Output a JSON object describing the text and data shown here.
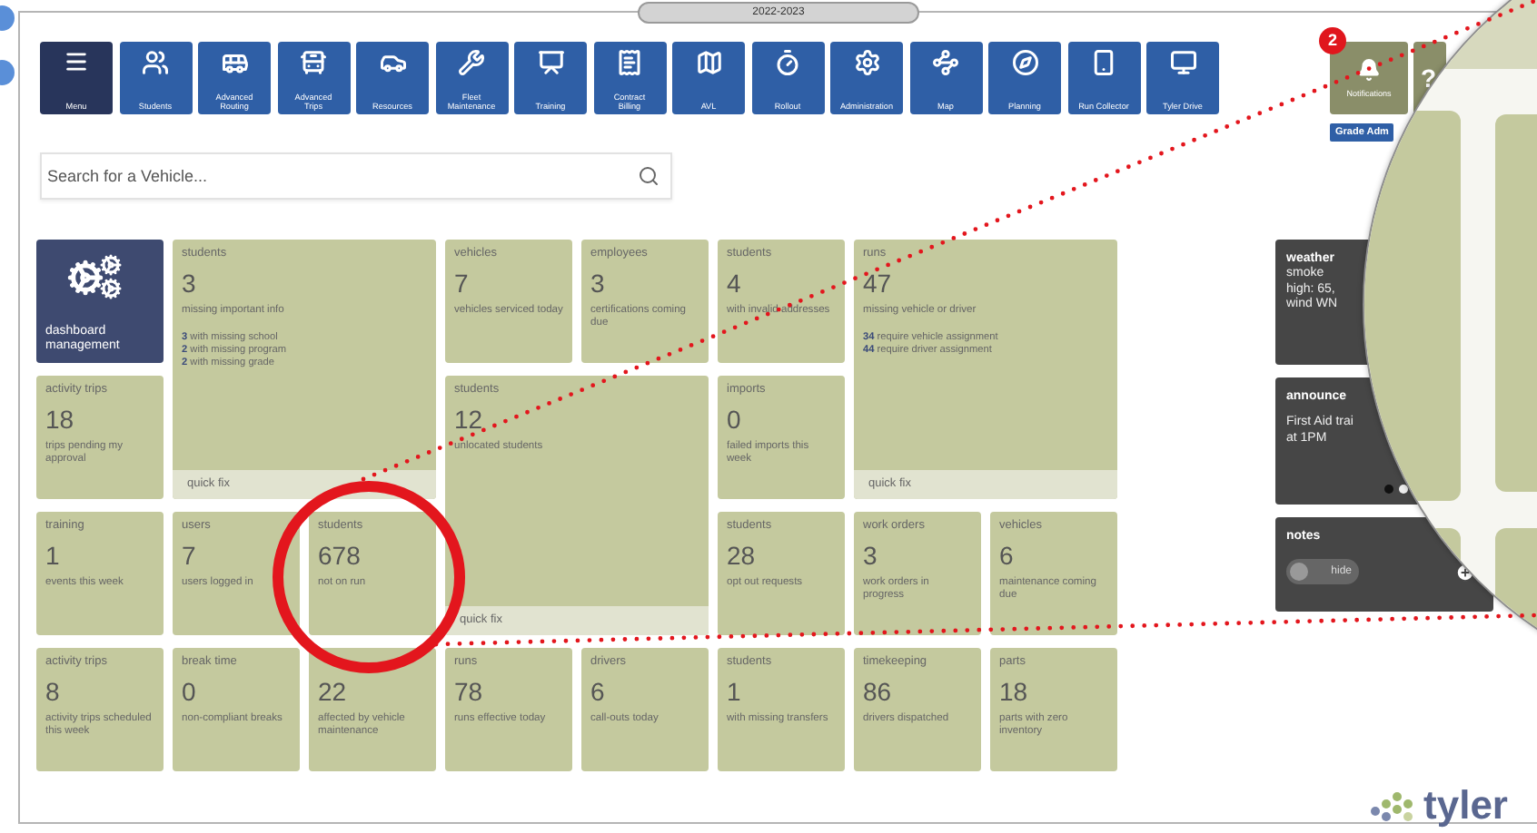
{
  "year_pill": "2022-2023",
  "toolbar": [
    {
      "label": "Menu",
      "kind": "menu"
    },
    {
      "label": "Students",
      "kind": "module"
    },
    {
      "label": "Advanced Routing",
      "kind": "module"
    },
    {
      "label": "Advanced Trips",
      "kind": "module"
    },
    {
      "label": "Resources",
      "kind": "module"
    },
    {
      "label": "Fleet Maintenance",
      "kind": "module"
    },
    {
      "label": "Training",
      "kind": "module"
    },
    {
      "label": "Contract Billing",
      "kind": "module"
    },
    {
      "label": "AVL",
      "kind": "module"
    },
    {
      "label": "Rollout",
      "kind": "module"
    },
    {
      "label": "Administration",
      "kind": "module"
    },
    {
      "label": "Map",
      "kind": "module"
    },
    {
      "label": "Planning",
      "kind": "module"
    },
    {
      "label": "Run Collector",
      "kind": "module"
    },
    {
      "label": "Tyler Drive",
      "kind": "module"
    }
  ],
  "notifications": {
    "label": "Notifications",
    "count": "2"
  },
  "help": {
    "label": "?"
  },
  "grade_badge": "Grade Adm",
  "search": {
    "placeholder": "Search for a Vehicle..."
  },
  "tiles": [
    {
      "kind": "management",
      "label": "dashboard management"
    },
    {
      "kind": "stat",
      "title": "students",
      "value": "3",
      "caption": "missing important info",
      "details": [
        "**3** with missing school",
        "**2** with missing program",
        "**2** with missing grade"
      ],
      "quick_fix": "quick fix"
    },
    {
      "kind": "stat",
      "title": "vehicles",
      "value": "7",
      "caption": "vehicles serviced today"
    },
    {
      "kind": "stat",
      "title": "employees",
      "value": "3",
      "caption": "certifications coming due"
    },
    {
      "kind": "stat",
      "title": "students",
      "value": "4",
      "caption": "with invalid addresses"
    },
    {
      "kind": "stat",
      "title": "runs",
      "value": "47",
      "caption": "missing vehicle or driver",
      "details": [
        "**34** require vehicle assignment",
        "**44** require driver assignment"
      ],
      "quick_fix": "quick fix"
    },
    {
      "kind": "stat",
      "title": "activity trips",
      "value": "18",
      "caption": "trips pending my approval"
    },
    {
      "kind": "stat",
      "title": "students",
      "value": "12",
      "caption": "unlocated students",
      "quick_fix": "quick fix"
    },
    {
      "kind": "stat",
      "title": "imports",
      "value": "0",
      "caption": "failed imports this week"
    },
    {
      "kind": "stat",
      "title": "training",
      "value": "1",
      "caption": "events this week"
    },
    {
      "kind": "stat",
      "title": "users",
      "value": "7",
      "caption": "users logged in"
    },
    {
      "kind": "stat",
      "title": "students",
      "value": "678",
      "caption": "not on run"
    },
    {
      "kind": "stat",
      "title": "students",
      "value": "28",
      "caption": "opt out requests"
    },
    {
      "kind": "stat",
      "title": "work orders",
      "value": "3",
      "caption": "work orders in progress"
    },
    {
      "kind": "stat",
      "title": "vehicles",
      "value": "6",
      "caption": "maintenance coming due"
    },
    {
      "kind": "stat",
      "title": "activity trips",
      "value": "8",
      "caption": "activity trips scheduled this week"
    },
    {
      "kind": "stat",
      "title": "break time",
      "value": "0",
      "caption": "non-compliant breaks"
    },
    {
      "kind": "stat",
      "value": "22",
      "caption": "affected by vehicle maintenance"
    },
    {
      "kind": "stat",
      "title": "runs",
      "value": "78",
      "caption": "runs effective today"
    },
    {
      "kind": "stat",
      "title": "drivers",
      "value": "6",
      "caption": "call-outs today"
    },
    {
      "kind": "stat",
      "title": "students",
      "value": "1",
      "caption": "with missing transfers"
    },
    {
      "kind": "stat",
      "title": "timekeeping",
      "value": "86",
      "caption": "drivers dispatched"
    },
    {
      "kind": "stat",
      "title": "parts",
      "value": "18",
      "caption": "parts with zero inventory"
    }
  ],
  "weather": {
    "title": "weather",
    "lines": [
      "smoke",
      "high: 65,",
      "wind WN"
    ]
  },
  "announcements": {
    "title": "announce",
    "lines": [
      "First Aid trai",
      "at 1PM"
    ],
    "dots": [
      {
        "selected": true
      },
      {
        "selected": false
      }
    ]
  },
  "notes": {
    "title": "notes",
    "toggle": {
      "label": "hide",
      "on": false
    }
  },
  "logo": {
    "text": "tyler"
  }
}
